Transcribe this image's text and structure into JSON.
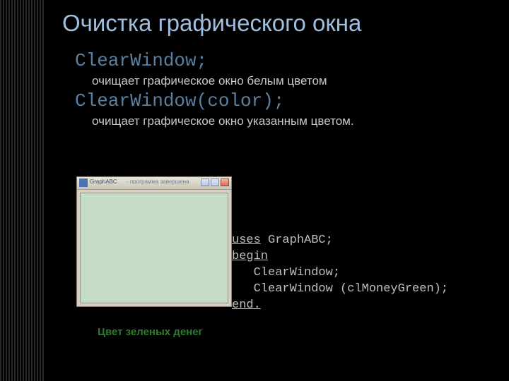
{
  "title": "Очистка графического окна",
  "api": {
    "cw1_name": "ClearWindow;",
    "cw1_desc": "очищает графическое окно белым цветом",
    "cw2_name": "ClearWindow(color);",
    "cw2_desc": "очищает графическое окно указанным цветом."
  },
  "demo_window": {
    "icon_label": "app-icon",
    "title": "GraphABC",
    "subtitle": "- программа завершена"
  },
  "code": {
    "kw_uses": "uses",
    "lib": " GraphABC;",
    "kw_begin": "begin",
    "line1": "   ClearWindow;",
    "line2": "   ClearWindow (clMoneyGreen);",
    "kw_end": "end."
  },
  "caption": "Цвет зеленых денег",
  "colors": {
    "title": "#9fbfe0",
    "api_name": "#5b7fa0",
    "canvas": "#c4dcc4",
    "caption": "#2e7a2e"
  }
}
